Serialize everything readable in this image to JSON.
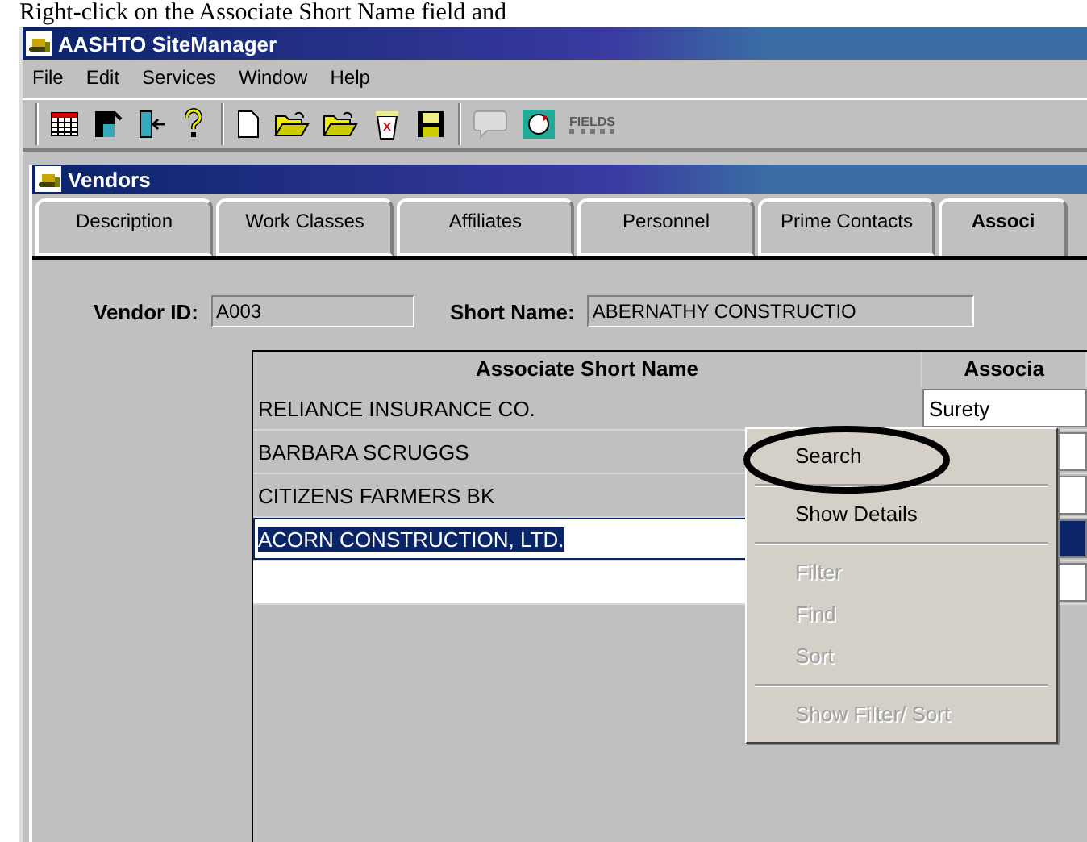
{
  "caption": "Right-click on the Associate Short Name field and",
  "window": {
    "title": "AASHTO SiteManager"
  },
  "menu": [
    "File",
    "Edit",
    "Services",
    "Window",
    "Help"
  ],
  "toolbar": [
    [
      {
        "kind": "table",
        "disabled": false
      },
      {
        "kind": "tool",
        "disabled": false
      },
      {
        "kind": "exit",
        "disabled": false
      },
      {
        "kind": "help",
        "disabled": false
      }
    ],
    [
      {
        "kind": "new",
        "disabled": false
      },
      {
        "kind": "open",
        "disabled": false
      },
      {
        "kind": "open",
        "disabled": false
      },
      {
        "kind": "bin",
        "disabled": false
      },
      {
        "kind": "save",
        "disabled": false
      }
    ],
    [
      {
        "kind": "bubble",
        "disabled": true
      },
      {
        "kind": "arrows",
        "disabled": false
      },
      {
        "kind": "fields",
        "label": "FIELDS",
        "disabled": true
      }
    ]
  ],
  "child_window": {
    "title": "Vendors"
  },
  "tabs": [
    {
      "label": "Description",
      "selected": false
    },
    {
      "label": "Work Classes",
      "selected": false
    },
    {
      "label": "Affiliates",
      "selected": false
    },
    {
      "label": "Personnel",
      "selected": false
    },
    {
      "label": "Prime Contacts",
      "selected": false
    },
    {
      "label": "Associ",
      "selected": true
    }
  ],
  "vendor_id": {
    "label": "Vendor ID:",
    "value": "A003"
  },
  "short_name": {
    "label": "Short Name:",
    "value": "ABERNATHY CONSTRUCTIO"
  },
  "table": {
    "columns": [
      "Associate Short Name",
      "Associa"
    ],
    "rows": [
      {
        "name": "RELIANCE INSURANCE CO.",
        "column_2": "Surety",
        "selected": false
      },
      {
        "name": "BARBARA SCRUGGS",
        "selected": false
      },
      {
        "name": "CITIZENS FARMERS BK",
        "selected": false
      },
      {
        "name": "ACORN CONSTRUCTION, LTD.",
        "selected": true
      }
    ]
  },
  "context_menu": [
    {
      "kind": "item",
      "label": "Search",
      "disabled": false,
      "circled": true
    },
    {
      "kind": "separator"
    },
    {
      "kind": "item",
      "label": "Show Details",
      "disabled": false,
      "circled": false
    },
    {
      "kind": "separator"
    },
    {
      "kind": "item",
      "label": "Filter",
      "disabled": true,
      "circled": false
    },
    {
      "kind": "item",
      "label": "Find",
      "disabled": true,
      "circled": false
    },
    {
      "kind": "item",
      "label": "Sort",
      "disabled": true,
      "circled": false
    },
    {
      "kind": "separator"
    },
    {
      "kind": "item",
      "label": "Show Filter/ Sort",
      "disabled": true,
      "circled": false
    }
  ]
}
